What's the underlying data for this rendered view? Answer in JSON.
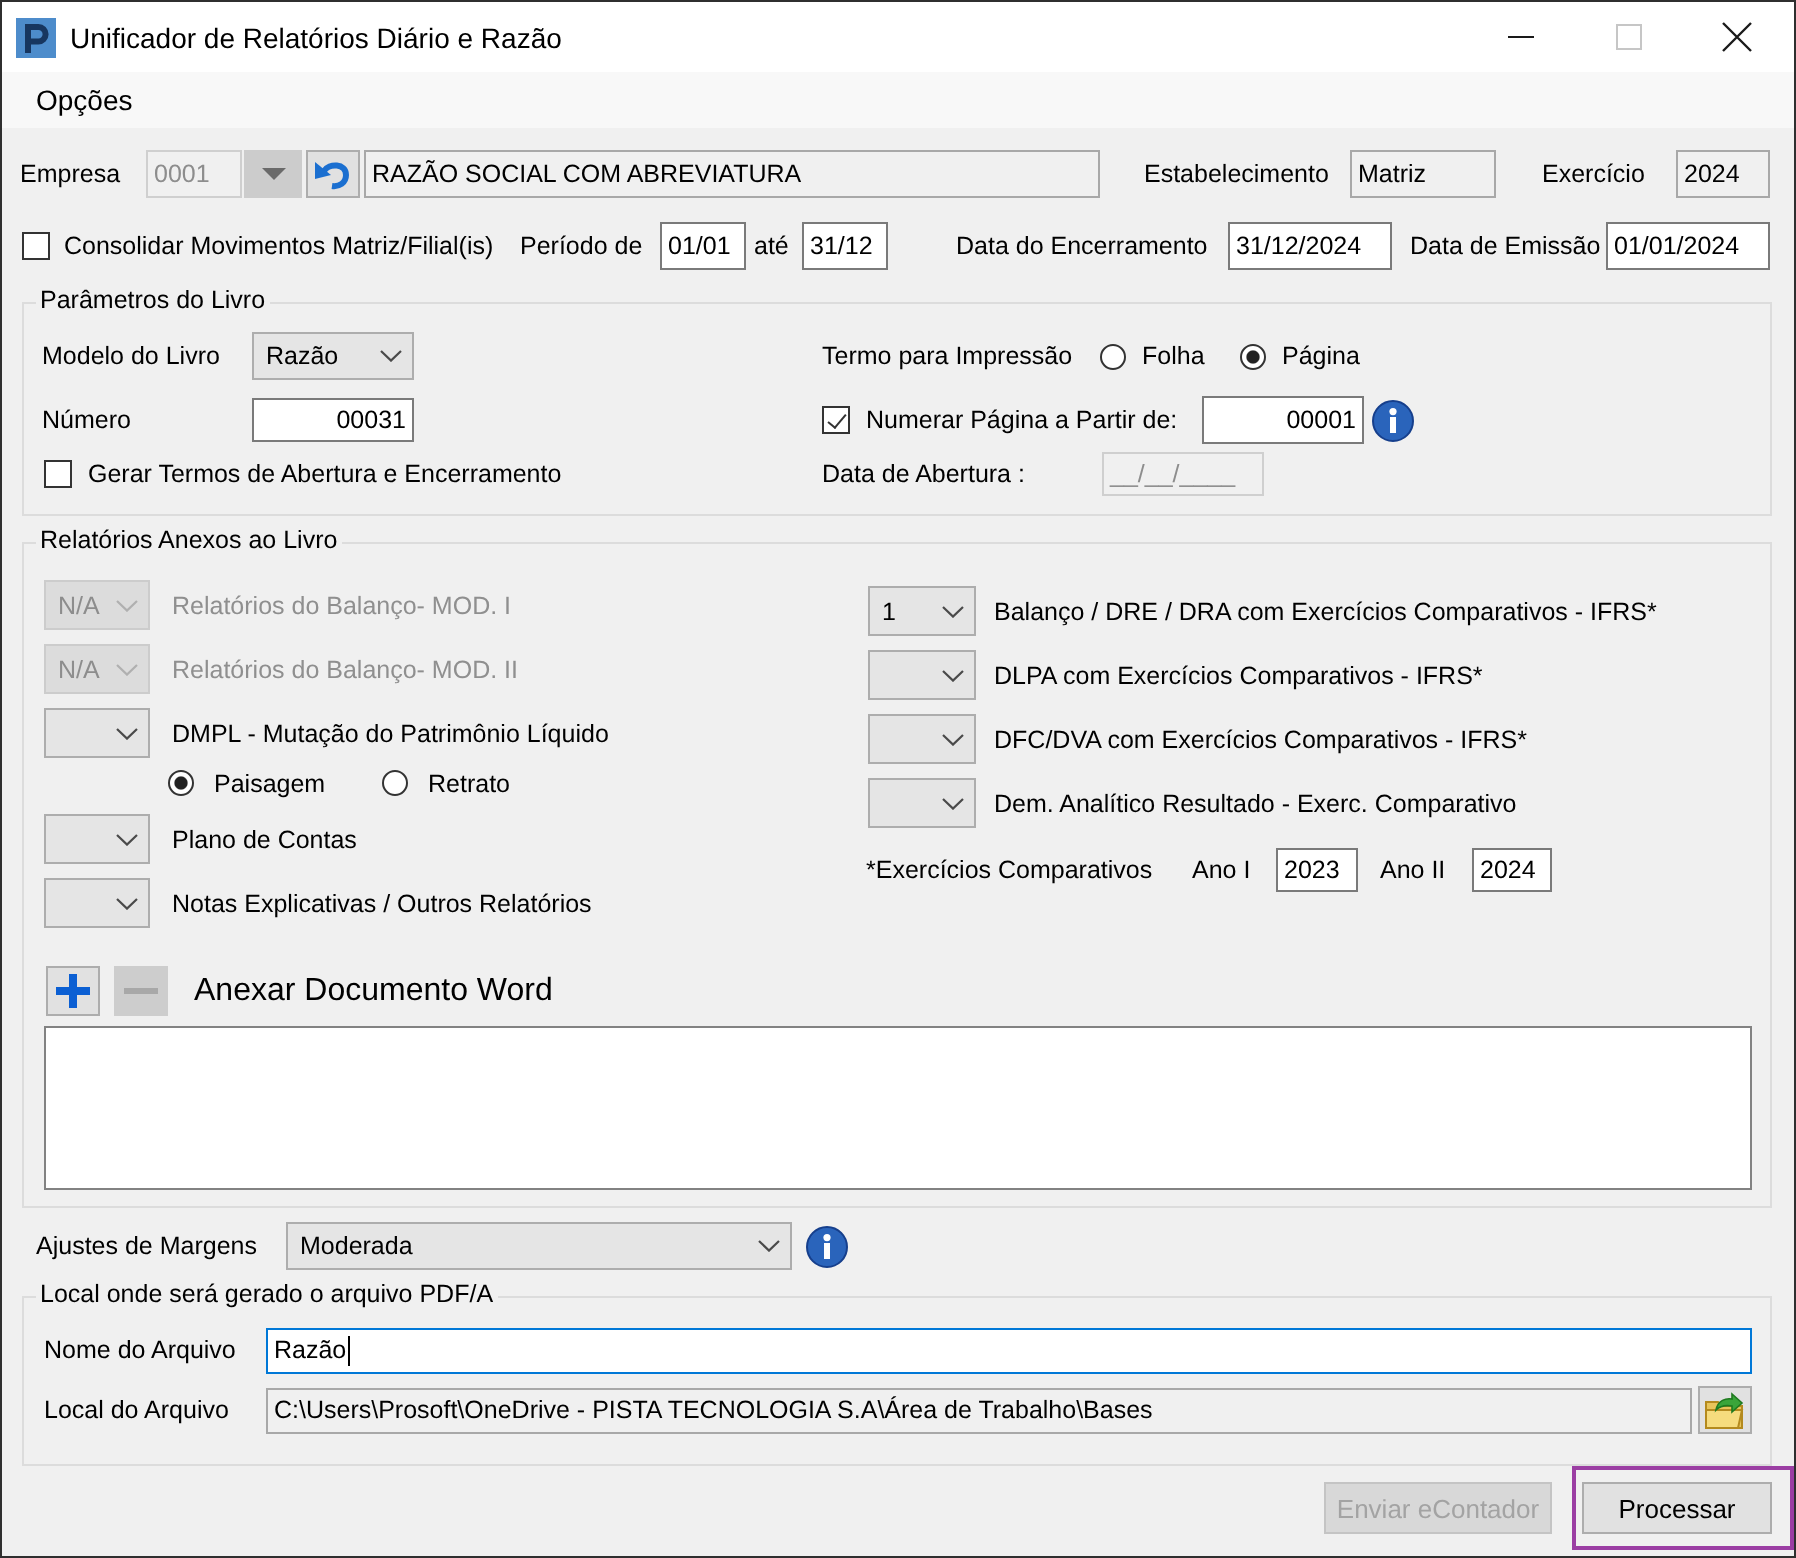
{
  "window": {
    "title": "Unificador de Relatórios Diário e Razão",
    "controls": [
      {
        "kind": "minimize",
        "disabled": false
      },
      {
        "kind": "maximize",
        "disabled": true
      },
      {
        "kind": "close",
        "disabled": false
      }
    ]
  },
  "menu": [
    {
      "label": "Opções"
    }
  ],
  "header": {
    "empresa": {
      "label": "Empresa",
      "code": {
        "value": "0001",
        "disabled": true
      },
      "name": {
        "value": "RAZÃO SOCIAL COM ABREVIATURA",
        "readonly": true
      }
    },
    "estabelecimento": {
      "label": "Estabelecimento",
      "field": {
        "value": "Matriz",
        "readonly": true
      }
    },
    "exercicio": {
      "label": "Exercício",
      "field": {
        "value": "2024",
        "readonly": true
      }
    },
    "consolidar": {
      "label": "Consolidar Movimentos Matriz/Filial(is)",
      "checked": false
    },
    "periodo": {
      "label": "Período de",
      "from": {
        "value": "01/01",
        "readonly": false
      },
      "separator": "até",
      "to": {
        "value": "31/12",
        "readonly": false
      }
    },
    "encerramento": {
      "label": "Data do Encerramento",
      "field": {
        "value": "31/12/2024",
        "readonly": false
      }
    },
    "emissao": {
      "label": "Data de Emissão",
      "field": {
        "value": "01/01/2024",
        "readonly": false
      }
    }
  },
  "parametros": {
    "title": "Parâmetros do Livro",
    "modelo": {
      "label": "Modelo do Livro",
      "value": "Razão"
    },
    "numero": {
      "label": "Número",
      "field": {
        "value": "00031",
        "readonly": false
      }
    },
    "gerar_termos": {
      "label": "Gerar Termos de Abertura e Encerramento",
      "checked": false
    },
    "termo": {
      "label": "Termo para Impressão",
      "options": [
        {
          "label": "Folha",
          "selected": false
        },
        {
          "label": "Página",
          "selected": true
        }
      ]
    },
    "numerar": {
      "label": "Numerar Página a Partir de:",
      "checked": true,
      "field": {
        "value": "00001",
        "readonly": false
      }
    },
    "abertura": {
      "label": "Data de Abertura :",
      "field": {
        "value": "__/__/____",
        "disabled": true
      }
    }
  },
  "relatorios": {
    "title": "Relatórios Anexos ao Livro",
    "left": [
      {
        "value": "N/A",
        "label": "Relatórios do Balanço- MOD. I",
        "disabled": true
      },
      {
        "value": "N/A",
        "label": "Relatórios do Balanço- MOD. II",
        "disabled": true
      },
      {
        "label": "DMPL - Mutação do Patrimônio Líquido",
        "disabled": false,
        "options": [
          {
            "label": "Paisagem",
            "selected": true
          },
          {
            "label": "Retrato",
            "selected": false
          }
        ]
      },
      {
        "label": "Plano de Contas",
        "disabled": false
      },
      {
        "label": "Notas Explicativas / Outros Relatórios",
        "disabled": false
      }
    ],
    "right": [
      {
        "value": "1",
        "label": "Balanço / DRE / DRA com Exercícios Comparativos - IFRS*",
        "disabled": false
      },
      {
        "label": "DLPA com Exercícios Comparativos - IFRS*",
        "disabled": false
      },
      {
        "label": "DFC/DVA com Exercícios Comparativos - IFRS*",
        "disabled": false
      },
      {
        "label": "Dem. Analítico Resultado - Exerc. Comparativo",
        "disabled": false
      }
    ],
    "comparativos": {
      "label": "*Exercícios Comparativos",
      "years": [
        {
          "label": "Ano I",
          "value": "2023"
        },
        {
          "label": "Ano II",
          "value": "2024"
        }
      ]
    },
    "anexar": {
      "label": "Anexar Documento Word",
      "buttons": [
        {
          "kind": "add",
          "disabled": false
        },
        {
          "kind": "remove",
          "disabled": true
        }
      ]
    }
  },
  "margens": {
    "label": "Ajustes de Margens",
    "value": "Moderada"
  },
  "pdf": {
    "title": "Local onde será gerado o arquivo PDF/A",
    "fields": [
      {
        "label": "Nome do Arquivo",
        "value": "Razão",
        "focused": true,
        "readonly": false,
        "browse": false
      },
      {
        "label": "Local do Arquivo",
        "value": "C:\\Users\\Prosoft\\OneDrive - PISTA TECNOLOGIA S.A\\Área de Trabalho\\Bases",
        "focused": false,
        "readonly": true,
        "browse": true
      }
    ]
  },
  "buttons": [
    {
      "label": "Enviar eContador",
      "disabled": true,
      "highlighted": false
    },
    {
      "label": "Processar",
      "disabled": false,
      "highlighted": true
    }
  ]
}
